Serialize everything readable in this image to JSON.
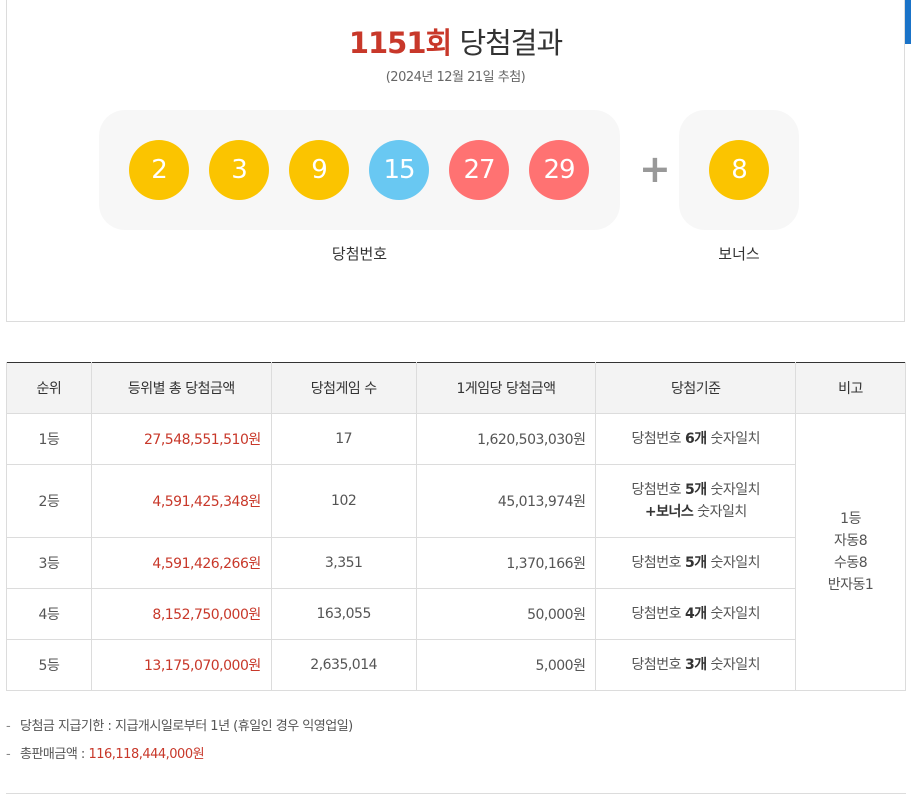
{
  "header": {
    "round": "1151회",
    "title": "당첨결과",
    "draw_date": "(2024년 12월 21일 추첨)"
  },
  "numbers": {
    "main": [
      {
        "value": "2",
        "color": "#fbc400"
      },
      {
        "value": "3",
        "color": "#fbc400"
      },
      {
        "value": "9",
        "color": "#fbc400"
      },
      {
        "value": "15",
        "color": "#69c8f2"
      },
      {
        "value": "27",
        "color": "#ff7272"
      },
      {
        "value": "29",
        "color": "#ff7272"
      }
    ],
    "plus": "+",
    "bonus": {
      "value": "8",
      "color": "#fbc400"
    },
    "main_label": "당첨번호",
    "bonus_label": "보너스"
  },
  "table": {
    "headers": [
      "순위",
      "등위별 총 당첨금액",
      "당첨게임 수",
      "1게임당 당첨금액",
      "당첨기준",
      "비고"
    ],
    "rows": [
      {
        "rank": "1등",
        "total": "27,548,551,510원",
        "games": "17",
        "per_game": "1,620,503,030원",
        "crit_pre": "당첨번호 ",
        "crit_bold": "6개",
        "crit_post": " 숫자일치",
        "crit_line2": ""
      },
      {
        "rank": "2등",
        "total": "4,591,425,348원",
        "games": "102",
        "per_game": "45,013,974원",
        "crit_pre": "당첨번호 ",
        "crit_bold": "5개",
        "crit_post": " 숫자일치",
        "crit_line2_bold": "+보너스",
        "crit_line2_post": " 숫자일치"
      },
      {
        "rank": "3등",
        "total": "4,591,426,266원",
        "games": "3,351",
        "per_game": "1,370,166원",
        "crit_pre": "당첨번호 ",
        "crit_bold": "5개",
        "crit_post": " 숫자일치"
      },
      {
        "rank": "4등",
        "total": "8,152,750,000원",
        "games": "163,055",
        "per_game": "50,000원",
        "crit_pre": "당첨번호 ",
        "crit_bold": "4개",
        "crit_post": " 숫자일치"
      },
      {
        "rank": "5등",
        "total": "13,175,070,000원",
        "games": "2,635,014",
        "per_game": "5,000원",
        "crit_pre": "당첨번호 ",
        "crit_bold": "3개",
        "crit_post": " 숫자일치"
      }
    ],
    "note": [
      "1등",
      "자동8",
      "수동8",
      "반자동1"
    ]
  },
  "footnotes": {
    "dash": "-",
    "deadline": "당첨금 지급기한 : 지급개시일로부터 1년 (휴일인 경우 익영업일)",
    "sales_label": "총판매금액 : ",
    "sales_value": "116,118,444,000원"
  }
}
